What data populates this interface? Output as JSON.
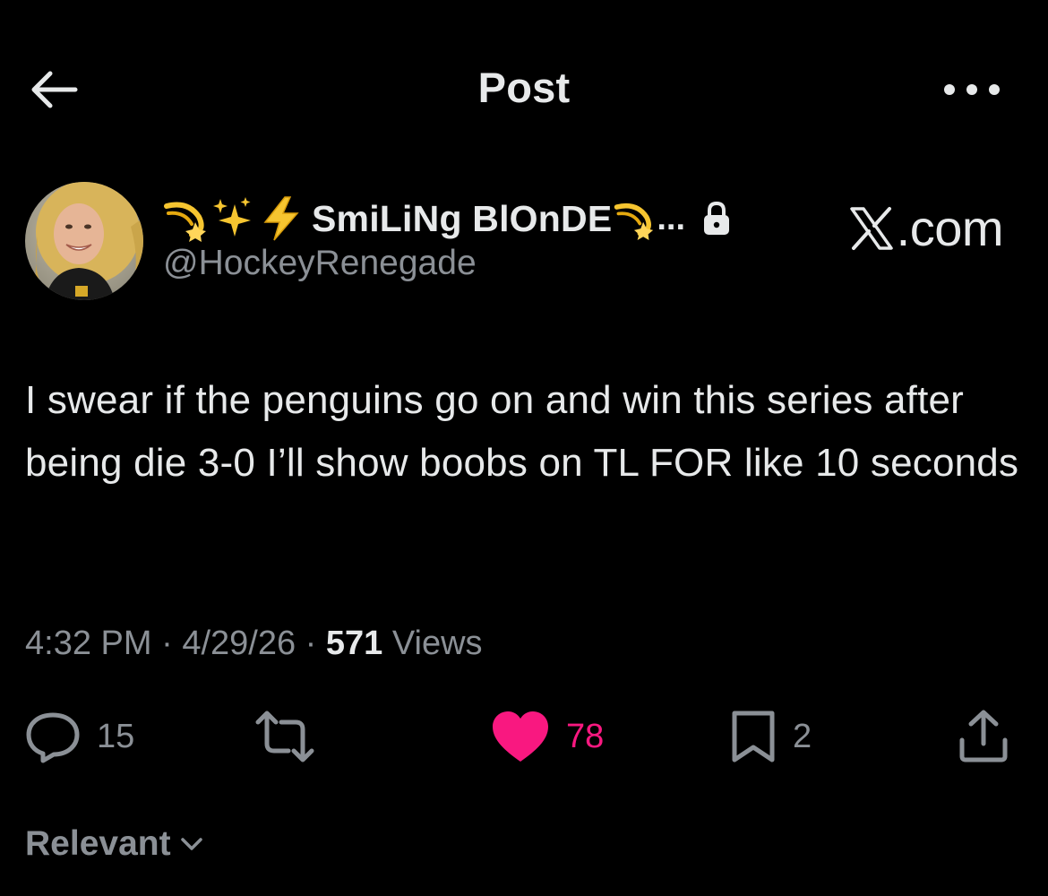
{
  "header": {
    "title": "Post",
    "back_icon": "arrow-left-icon",
    "more_icon": "more-horizontal-icon"
  },
  "author": {
    "display_name_emojis": [
      "dizzy-emoji",
      "sparkles-emoji",
      "high-voltage-emoji"
    ],
    "display_name": "SmiLiNg BlOnDE",
    "display_name_trailing_emoji": "dizzy-emoji",
    "truncation": "...",
    "lock_icon": "lock-icon",
    "handle": "@HockeyRenegade",
    "source_label": ".com",
    "source_logo": "x-logo"
  },
  "post": {
    "text": "I swear if the penguins go on and win this series after being die 3-0 I’ll show boobs on TL FOR like 10 seconds"
  },
  "meta": {
    "time": "4:32 PM",
    "separator": " · ",
    "date": "4/29/26",
    "views_count": "571",
    "views_label": " Views"
  },
  "actions": {
    "replies": "15",
    "reposts": "",
    "likes": "78",
    "bookmarks": "2"
  },
  "sort": {
    "label": "Relevant"
  },
  "colors": {
    "background": "#000000",
    "text": "#e7e9ea",
    "secondary": "#8b9096",
    "like": "#f91880"
  }
}
